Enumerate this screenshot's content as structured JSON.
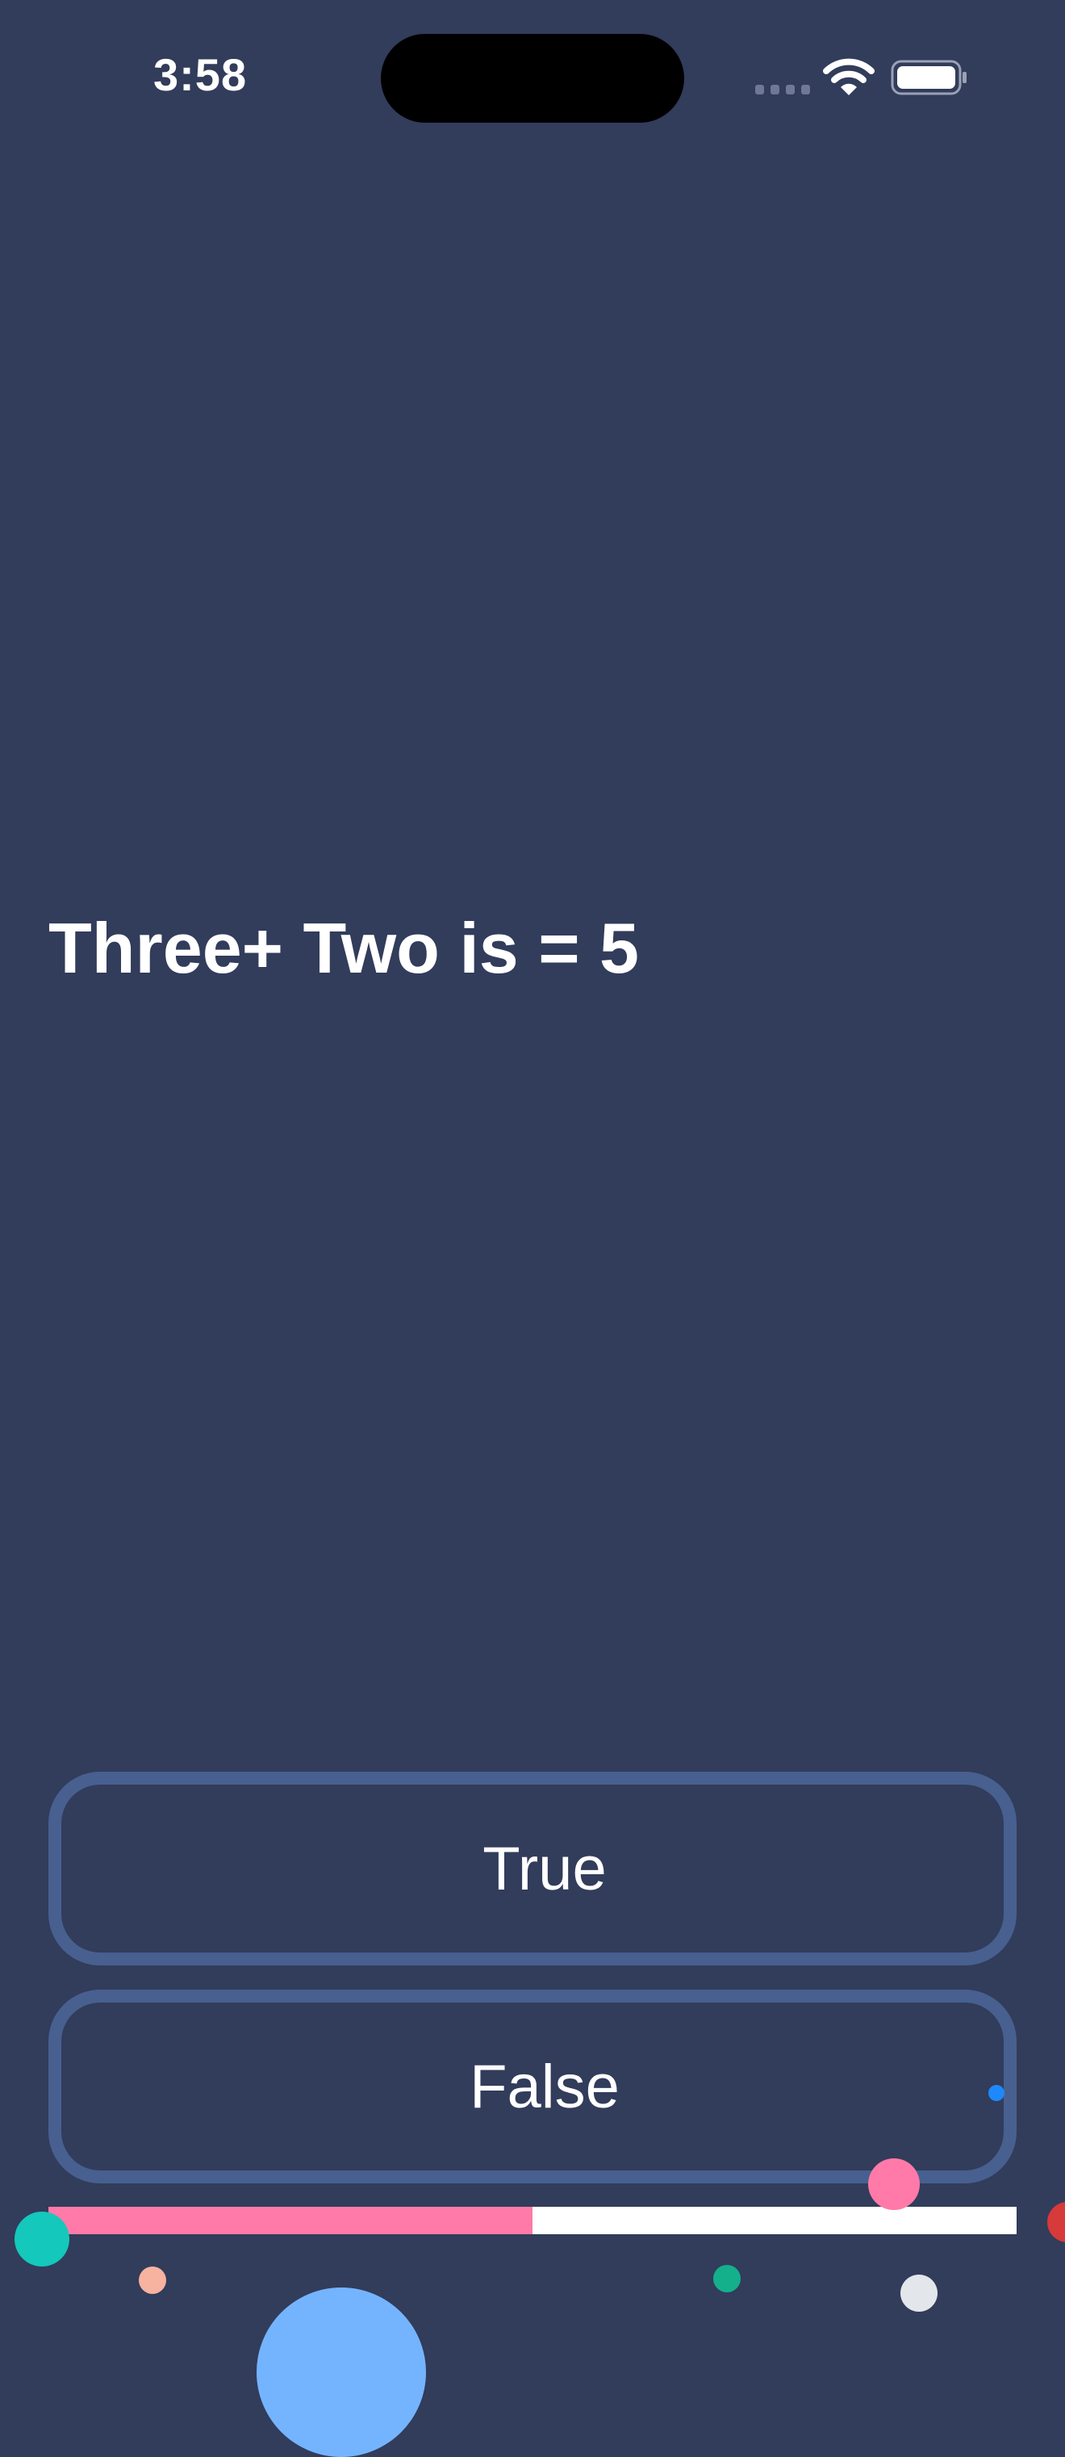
{
  "status_bar": {
    "time": "3:58",
    "icons": [
      "signal-icon",
      "wifi-icon",
      "battery-icon"
    ]
  },
  "quiz": {
    "question": "Three+ Two is = 5",
    "answers": [
      {
        "label": "True"
      },
      {
        "label": "False"
      }
    ],
    "progress": 0.5
  },
  "colors": {
    "background": "#323c5b",
    "button_border": "#47608f",
    "progress_fill": "#ff7aa8",
    "progress_track": "#ffffff",
    "text": "#ffffff"
  }
}
